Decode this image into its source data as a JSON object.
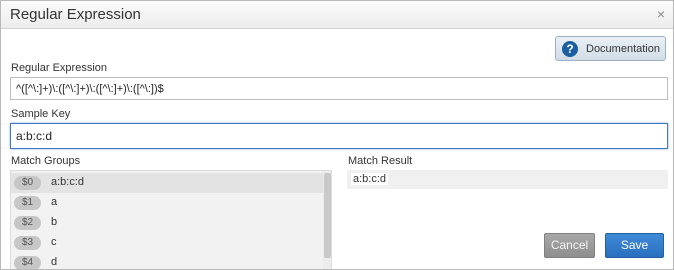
{
  "dialog": {
    "title": "Regular Expression",
    "close_symbol": "×"
  },
  "documentation": {
    "icon_symbol": "?",
    "label": "Documentation"
  },
  "regex": {
    "label": "Regular Expression",
    "value": "^([^\\:]+)\\:([^\\:]+)\\:([^\\:]+)\\:([^\\:])$"
  },
  "sample_key": {
    "label": "Sample Key",
    "value": "a:b:c:d"
  },
  "match_groups": {
    "label": "Match Groups",
    "items": [
      {
        "group": "$0",
        "value": "a:b:c:d"
      },
      {
        "group": "$1",
        "value": "a"
      },
      {
        "group": "$2",
        "value": "b"
      },
      {
        "group": "$3",
        "value": "c"
      },
      {
        "group": "$4",
        "value": "d"
      }
    ]
  },
  "match_result": {
    "label": "Match Result",
    "value": "a:b:c:d"
  },
  "buttons": {
    "cancel": "Cancel",
    "save": "Save"
  }
}
